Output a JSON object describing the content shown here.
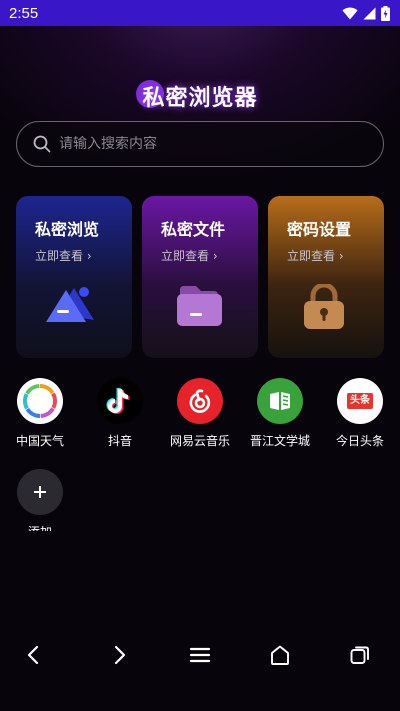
{
  "status": {
    "time": "2:55"
  },
  "app": {
    "title": "私密浏览器"
  },
  "search": {
    "placeholder": "请输入搜索内容"
  },
  "cards": [
    {
      "title": "私密浏览",
      "sub": "立即查看 ›",
      "icon": "mountain-icon"
    },
    {
      "title": "私密文件",
      "sub": "立即查看 ›",
      "icon": "folder-icon"
    },
    {
      "title": "密码设置",
      "sub": "立即查看 ›",
      "icon": "lock-icon"
    }
  ],
  "apps": [
    {
      "label": "中国天气",
      "icon": "china-weather-icon"
    },
    {
      "label": "抖音",
      "icon": "douyin-icon"
    },
    {
      "label": "网易云音乐",
      "icon": "netease-music-icon"
    },
    {
      "label": "晋江文学城",
      "icon": "jinjiang-icon"
    },
    {
      "label": "今日头条",
      "icon": "toutiao-icon",
      "icon_text": "头条"
    }
  ],
  "add": {
    "label": "添加"
  },
  "colors": {
    "status_bar": "#3a16c9",
    "accent": "#9b3cff",
    "netease_red": "#e6232a",
    "jinjiang_green": "#3aa23a",
    "toutiao_red": "#e8342c"
  }
}
